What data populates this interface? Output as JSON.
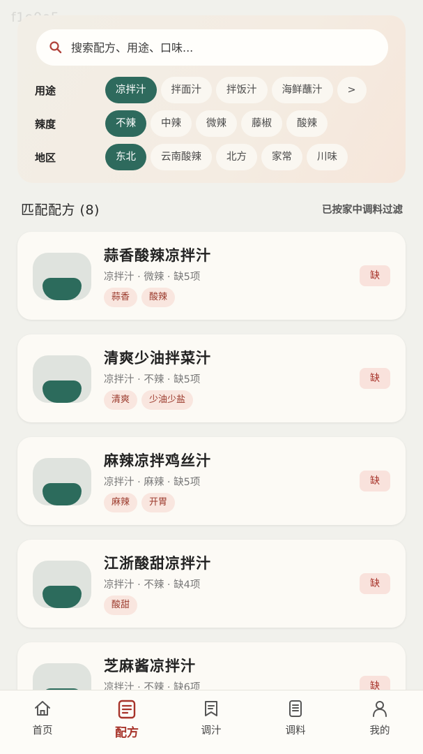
{
  "watermark": "f1e0e5",
  "search": {
    "placeholder": "搜索配方、用途、口味..."
  },
  "filters": [
    {
      "label": "用途",
      "options": [
        "凉拌汁",
        "拌面汁",
        "拌饭汁",
        "海鲜蘸汁",
        ">"
      ],
      "selected": "凉拌汁"
    },
    {
      "label": "辣度",
      "options": [
        "不辣",
        "中辣",
        "微辣",
        "藤椒",
        "酸辣"
      ],
      "selected": "不辣"
    },
    {
      "label": "地区",
      "options": [
        "东北",
        "云南酸辣",
        "北方",
        "家常",
        "川味"
      ],
      "selected": "东北"
    }
  ],
  "results": {
    "title": "匹配配方 (8)",
    "note": "已按家中调料过滤"
  },
  "recipes": [
    {
      "title": "蒜香酸辣凉拌汁",
      "meta": "凉拌汁 · 微辣 · 缺5项",
      "tags": [
        "蒜香",
        "酸辣"
      ],
      "badge": "缺"
    },
    {
      "title": "清爽少油拌菜汁",
      "meta": "凉拌汁 · 不辣 · 缺5项",
      "tags": [
        "清爽",
        "少油少盐"
      ],
      "badge": "缺"
    },
    {
      "title": "麻辣凉拌鸡丝汁",
      "meta": "凉拌汁 · 麻辣 · 缺5项",
      "tags": [
        "麻辣",
        "开胃"
      ],
      "badge": "缺"
    },
    {
      "title": "江浙酸甜凉拌汁",
      "meta": "凉拌汁 · 不辣 · 缺4项",
      "tags": [
        "酸甜"
      ],
      "badge": "缺"
    },
    {
      "title": "芝麻酱凉拌汁",
      "meta": "凉拌汁 · 不辣 · 缺6项",
      "tags": [],
      "badge": "缺"
    }
  ],
  "tabbar": [
    {
      "label": "首页",
      "icon": "home-icon",
      "active": false
    },
    {
      "label": "配方",
      "icon": "recipe-icon",
      "active": true
    },
    {
      "label": "调汁",
      "icon": "bookmark-icon",
      "active": false
    },
    {
      "label": "调料",
      "icon": "list-icon",
      "active": false
    },
    {
      "label": "我的",
      "icon": "user-icon",
      "active": false
    }
  ],
  "colors": {
    "accent": "#2e6a5d",
    "brand_red": "#a7332a",
    "background": "#f1f1ec"
  }
}
